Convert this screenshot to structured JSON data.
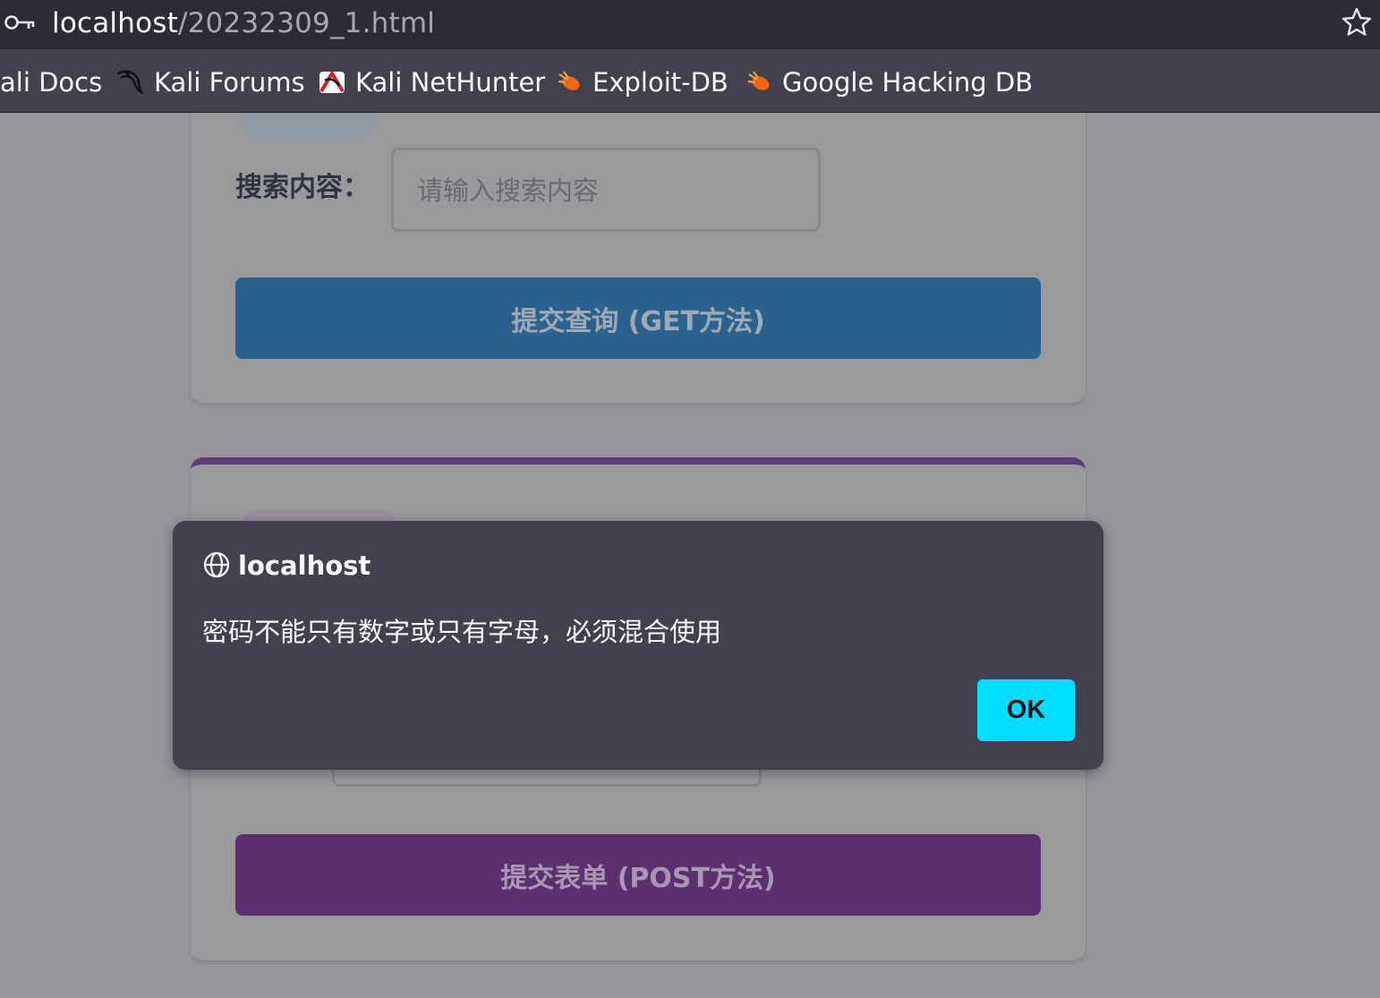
{
  "browser": {
    "url_host": "localhost",
    "url_path": "/20232309_1.html",
    "bookmarks": [
      {
        "label": "ali Docs",
        "icon": "none"
      },
      {
        "label": "Kali Forums",
        "icon": "kali-dragon-icon"
      },
      {
        "label": "Kali NetHunter",
        "icon": "nethunter-icon"
      },
      {
        "label": "Exploit-DB",
        "icon": "exploit-db-icon"
      },
      {
        "label": "Google Hacking DB",
        "icon": "exploit-db-icon"
      }
    ]
  },
  "page": {
    "search_label": "搜索内容：",
    "search_placeholder": "请输入搜索内容",
    "get_button": "提交查询 (GET方法)",
    "post_button": "提交表单 (POST方法)"
  },
  "dialog": {
    "title": "localhost",
    "message": "密码不能只有数字或只有字母，必须混合使用",
    "ok_label": "OK"
  },
  "colors": {
    "accent_ok": "#00ddff",
    "get_button": "#2a628d",
    "post_button": "#5c2f6e",
    "dialog_bg": "#42414d"
  }
}
